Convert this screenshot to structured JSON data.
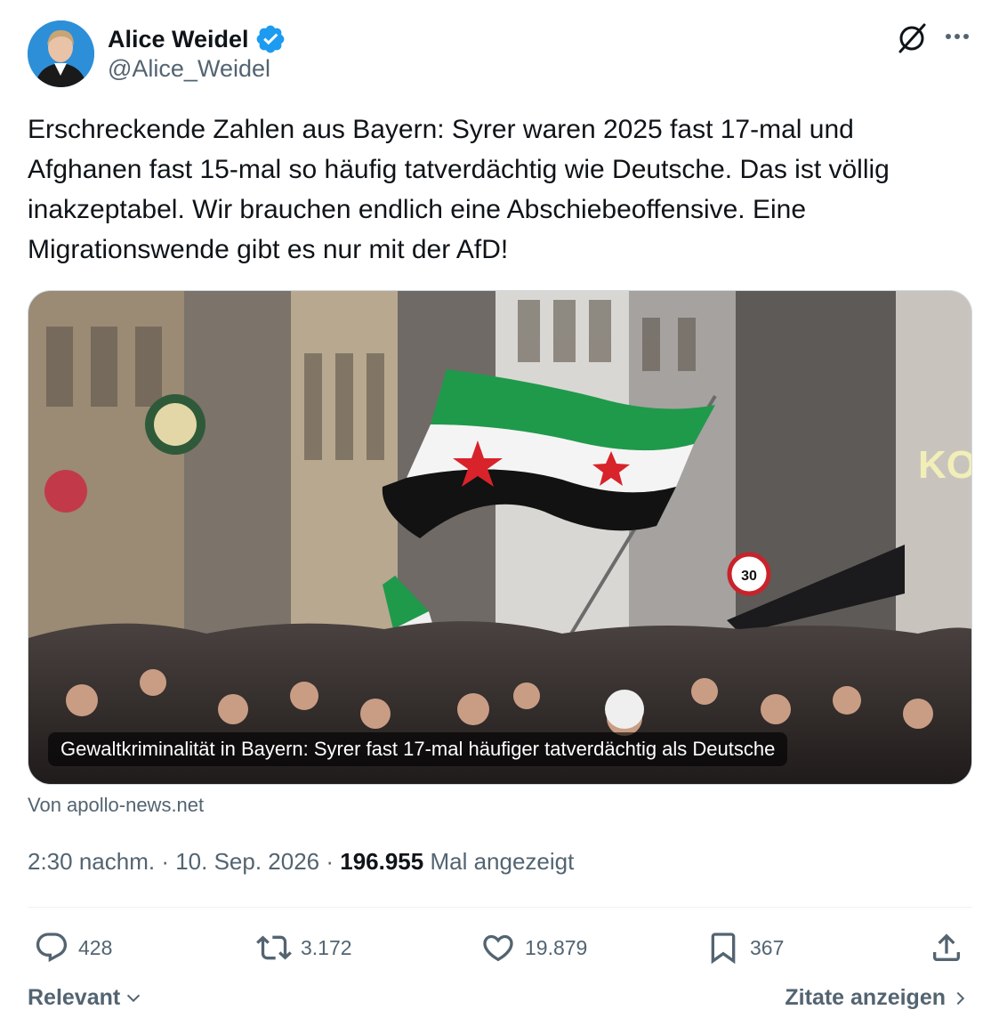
{
  "author": {
    "display_name": "Alice Weidel",
    "handle": "@Alice_Weidel",
    "verified": true,
    "verified_color": "#1d9bf0"
  },
  "tweet": {
    "text": "Erschreckende Zahlen aus Bayern: Syrer waren 2025 fast 17-mal und\nAfghanen fast 15-mal so häufig tatverdächtig wie Deutsche. Das ist völlig\ninakzeptabel. Wir brauchen endlich eine Abschiebeoffensive. Eine\nMigrationswende gibt es nur mit der AfD!"
  },
  "link_card": {
    "caption": "Gewaltkriminalität in Bayern: Syrer fast 17-mal häufiger tatverdächtig als Deutsche",
    "source": "Von apollo-news.net"
  },
  "meta": {
    "time": "2:30 nachm.",
    "separator": " · ",
    "date": "10. Sep. 2026",
    "views_count": "196.955",
    "views_label": "Mal angezeigt"
  },
  "actions": {
    "replies": "428",
    "reposts": "3.172",
    "likes": "19.879",
    "bookmarks": "367"
  },
  "footer": {
    "sort_label": "Relevant",
    "quotes_label": "Zitate anzeigen"
  },
  "icons": {
    "grok": "grok-icon",
    "more": "more-icon",
    "reply": "reply-icon",
    "repost": "repost-icon",
    "like": "like-icon",
    "bookmark": "bookmark-icon",
    "share": "share-icon"
  },
  "colors": {
    "text_primary": "#0f1419",
    "text_secondary": "#536471",
    "divider": "#eff3f4"
  }
}
